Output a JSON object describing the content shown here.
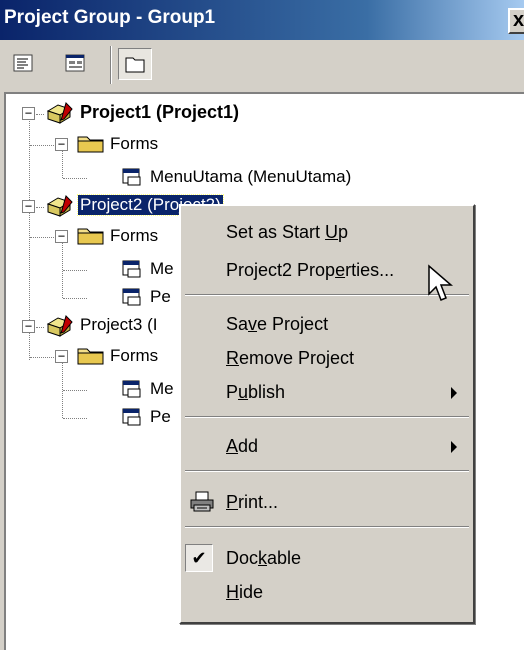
{
  "window": {
    "title": "Project Group - Group1",
    "close_glyph": "x"
  },
  "toolbar": {
    "view_code_icon": "view-code-icon",
    "view_object_icon": "view-object-icon",
    "toggle_folders_icon": "toggle-folders-icon"
  },
  "tree": {
    "project1": {
      "label": "Project1 (Project1)",
      "forms": "Forms",
      "form1": "MenuUtama (MenuUtama)"
    },
    "project2": {
      "label": "Project2 (Project2)",
      "forms": "Forms",
      "form1": "Me",
      "form2": "Pe"
    },
    "project3": {
      "label": "Project3 (I",
      "forms": "Forms",
      "form1": "Me",
      "form2": "Pe"
    },
    "expander_glyph": "−"
  },
  "context_menu": {
    "set_start_up": {
      "pre": "Set as Start ",
      "u": "U",
      "post": "p"
    },
    "properties": {
      "pre": "Project2 Prop",
      "u": "e",
      "post": "rties..."
    },
    "save": {
      "pre": "Sa",
      "u": "v",
      "post": "e Project"
    },
    "remove": {
      "pre": "",
      "u": "R",
      "post": "emove Project"
    },
    "publish": {
      "pre": "P",
      "u": "u",
      "post": "blish"
    },
    "add": {
      "pre": "",
      "u": "A",
      "post": "dd"
    },
    "print": {
      "pre": "",
      "u": "P",
      "post": "rint..."
    },
    "dockable": {
      "pre": "Doc",
      "u": "k",
      "post": "able",
      "checked": true,
      "check_glyph": "✔"
    },
    "hide": {
      "pre": "",
      "u": "H",
      "post": "ide"
    }
  },
  "colors": {
    "title_bar": "#0a246a",
    "selection": "#0a246a",
    "face": "#d4d0c8"
  }
}
